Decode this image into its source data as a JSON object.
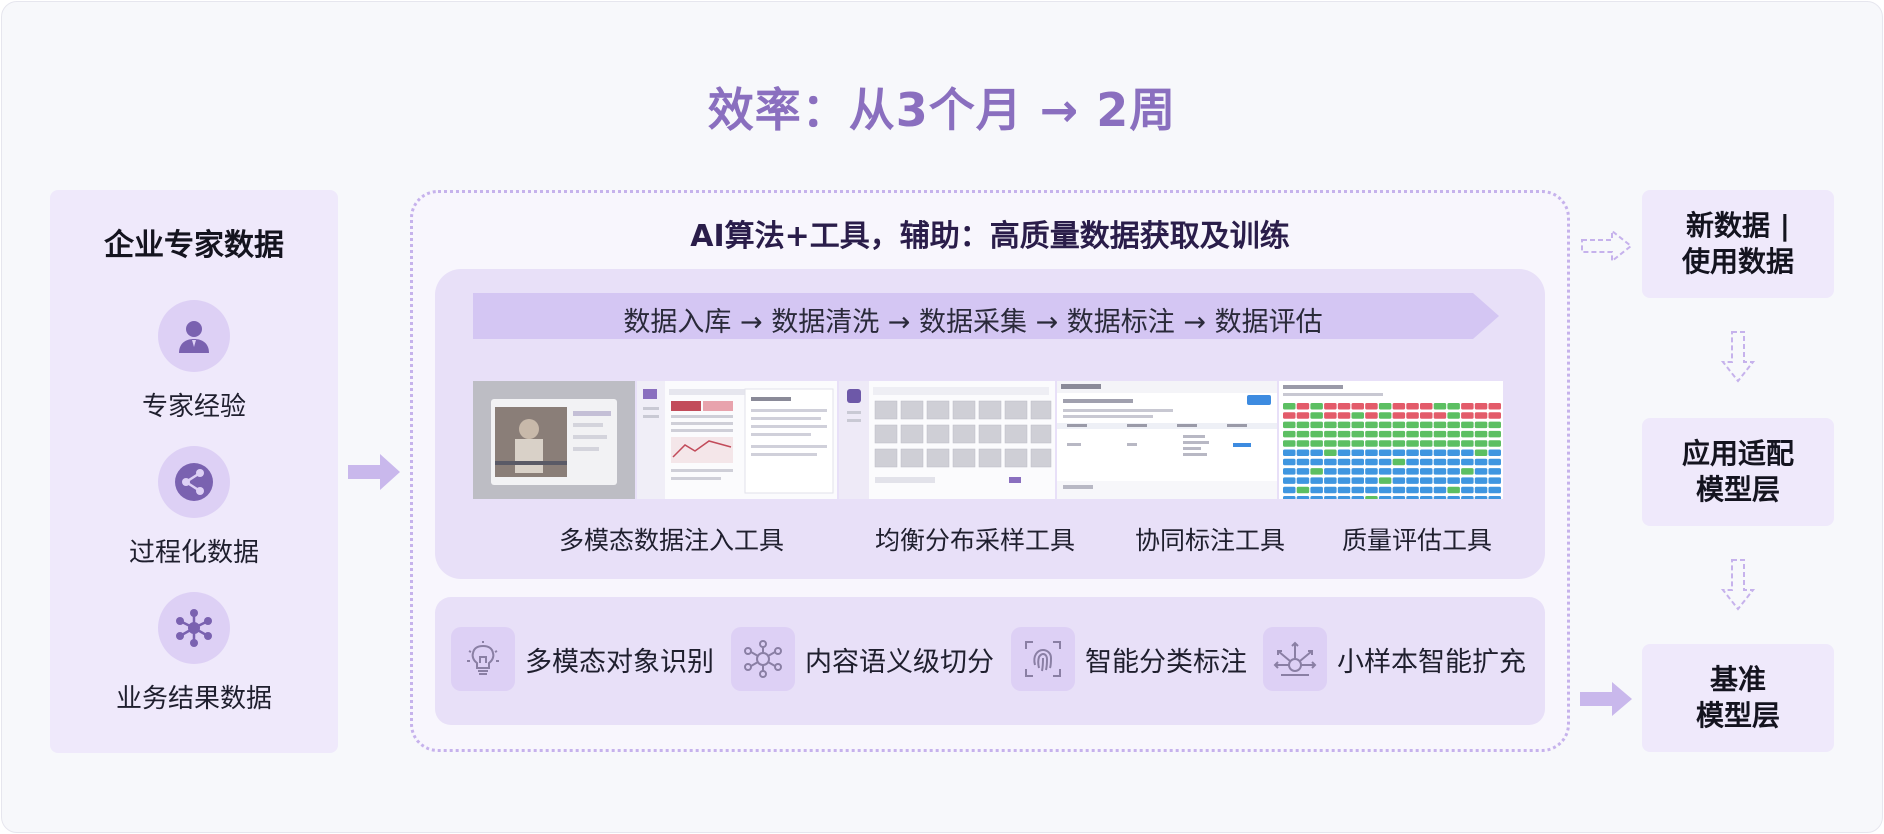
{
  "title": "效率：从3个月 → 2周",
  "left_panel": {
    "title": "企业专家数据",
    "items": [
      {
        "label": "专家经验",
        "icon": "user-icon"
      },
      {
        "label": "过程化数据",
        "icon": "share-icon"
      },
      {
        "label": "业务结果数据",
        "icon": "network-icon"
      }
    ]
  },
  "center": {
    "title": "AI算法+工具，辅助：高质量数据获取及训练",
    "pipeline": "数据入库 → 数据清洗 → 数据采集 → 数据标注 → 数据评估",
    "tools": [
      {
        "label": "多模态数据注入工具"
      },
      {
        "label": "均衡分布采样工具"
      },
      {
        "label": "协同标注工具"
      },
      {
        "label": "质量评估工具"
      }
    ],
    "features": [
      {
        "label": "多模态对象识别",
        "icon": "lightbulb-icon"
      },
      {
        "label": "内容语义级切分",
        "icon": "neural-icon"
      },
      {
        "label": "智能分类标注",
        "icon": "fingerprint-icon"
      },
      {
        "label": "小样本智能扩充",
        "icon": "expand-icon"
      }
    ]
  },
  "right_column": {
    "boxes": [
      {
        "line1": "新数据 |",
        "line2": "使用数据"
      },
      {
        "line1": "应用适配",
        "line2": "模型层"
      },
      {
        "line1": "基准",
        "line2": "模型层"
      }
    ]
  },
  "colors": {
    "accent": "#8a6fbf",
    "panel": "#efe9fb",
    "inner": "#e8e0f8",
    "icon_bg": "#ddd0f5",
    "arrow": "#c9b8ec"
  }
}
